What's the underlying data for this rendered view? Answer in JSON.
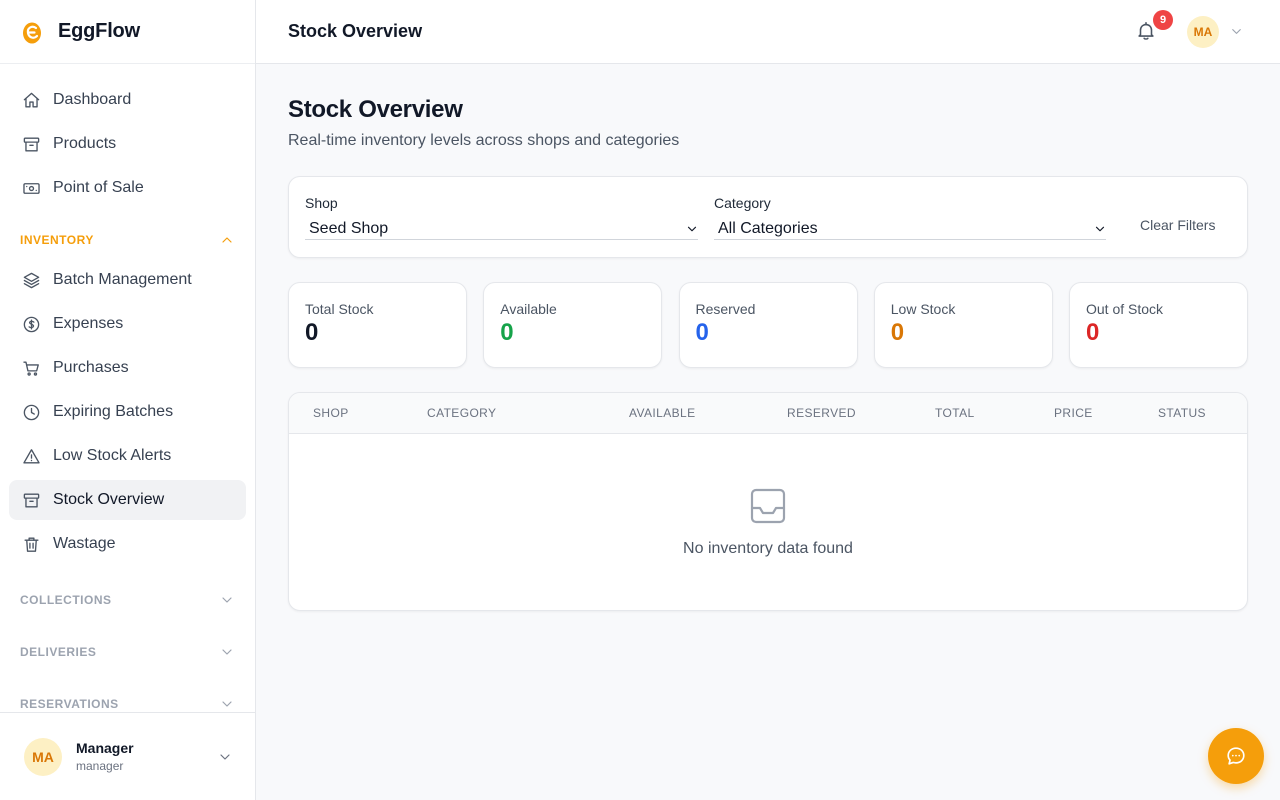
{
  "brand": {
    "name": "EggFlow"
  },
  "topbar": {
    "title": "Stock Overview",
    "notification_count": "9",
    "avatar_initials": "MA"
  },
  "sidebar": {
    "main_items": [
      {
        "label": "Dashboard",
        "icon": "home-icon"
      },
      {
        "label": "Products",
        "icon": "archive-icon"
      },
      {
        "label": "Point of Sale",
        "icon": "cash-icon"
      }
    ],
    "inventory": {
      "title": "INVENTORY",
      "items": [
        {
          "label": "Batch Management",
          "icon": "layers-icon"
        },
        {
          "label": "Expenses",
          "icon": "dollar-icon"
        },
        {
          "label": "Purchases",
          "icon": "cart-icon"
        },
        {
          "label": "Expiring Batches",
          "icon": "clock-icon"
        },
        {
          "label": "Low Stock Alerts",
          "icon": "alert-triangle-icon"
        },
        {
          "label": "Stock Overview",
          "icon": "archive-icon",
          "active": true
        },
        {
          "label": "Wastage",
          "icon": "trash-icon"
        }
      ]
    },
    "sections": [
      {
        "title": "COLLECTIONS"
      },
      {
        "title": "DELIVERIES"
      },
      {
        "title": "RESERVATIONS"
      }
    ],
    "user": {
      "initials": "MA",
      "name": "Manager",
      "role": "manager"
    }
  },
  "page": {
    "title": "Stock Overview",
    "subtitle": "Real-time inventory levels across shops and categories"
  },
  "filters": {
    "shop_label": "Shop",
    "shop_value": "Seed Shop",
    "category_label": "Category",
    "category_value": "All Categories",
    "clear_label": "Clear Filters"
  },
  "stats": [
    {
      "label": "Total Stock",
      "value": "0",
      "color": "#111827"
    },
    {
      "label": "Available",
      "value": "0",
      "color": "#16a34a"
    },
    {
      "label": "Reserved",
      "value": "0",
      "color": "#2563eb"
    },
    {
      "label": "Low Stock",
      "value": "0",
      "color": "#d97706"
    },
    {
      "label": "Out of Stock",
      "value": "0",
      "color": "#dc2626"
    }
  ],
  "table": {
    "columns": [
      "SHOP",
      "CATEGORY",
      "AVAILABLE",
      "RESERVED",
      "TOTAL",
      "PRICE",
      "STATUS"
    ],
    "empty_text": "No inventory data found"
  },
  "colors": {
    "accent": "#f59e0b",
    "badge": "#ef4444",
    "avatar_bg": "#fdf0c4"
  }
}
